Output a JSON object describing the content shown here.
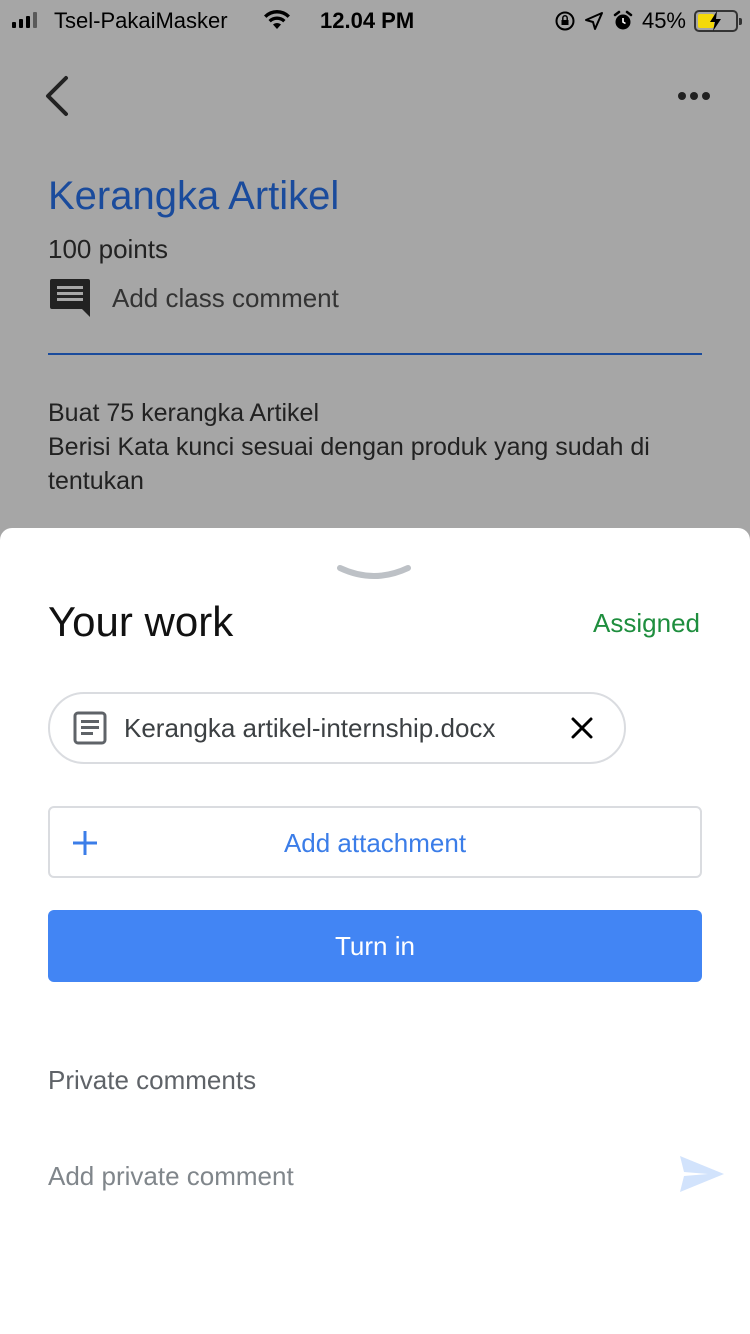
{
  "status_bar": {
    "carrier": "Tsel-PakaiMasker",
    "time": "12.04 PM",
    "battery": "45%"
  },
  "assignment": {
    "title": "Kerangka Artikel",
    "points": "100 points",
    "class_comment_label": "Add class comment",
    "description": [
      "Buat 75 kerangka Artikel",
      "Berisi Kata kunci sesuai dengan produk yang sudah di tentukan"
    ]
  },
  "work": {
    "heading": "Your work",
    "status": "Assigned",
    "status_color": "#1e8e3e",
    "attachment_file": "Kerangka artikel-internship.docx",
    "add_attachment_label": "Add attachment",
    "turn_in_label": "Turn in",
    "accent": "#4285f4"
  },
  "private_comments": {
    "heading": "Private comments",
    "placeholder": "Add private comment"
  },
  "icons": [
    "signal-icon",
    "wifi-icon",
    "orientation-lock-icon",
    "location-icon",
    "alarm-icon",
    "battery-icon",
    "back-arrow-icon",
    "more-icon",
    "comment-icon",
    "chevron-down-icon",
    "document-icon",
    "close-icon",
    "plus-icon",
    "send-icon"
  ]
}
